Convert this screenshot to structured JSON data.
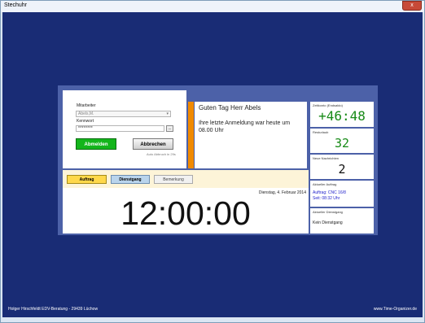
{
  "window": {
    "title": "Stechuhr",
    "close_glyph": "x"
  },
  "login": {
    "employee_label": "Mitarbeiter",
    "employee_value": "Abels,M.",
    "password_label": "Kennwort",
    "password_value": "********",
    "more_button": "...",
    "logout_button": "Abmelden",
    "cancel_button": "Abbrechen",
    "auto_cancel": "Auto Abbruch in 29s"
  },
  "greeting": {
    "headline": "Guten Tag Herr Abels",
    "message": "Ihre letzte Anmeldung war heute um 08.00 Uhr"
  },
  "tabs": [
    "Auftrag",
    "Dienstgang",
    "Bemerkung"
  ],
  "clock": {
    "date": "Dienstag, 4. Februar 2014",
    "time": "12:00:00"
  },
  "stats": {
    "zeitkonto": {
      "label": "Zeitkonto (Endsaldo)",
      "value": "+46:48"
    },
    "resturlaub": {
      "label": "Resturlaub",
      "value": "32"
    },
    "nachrichten": {
      "label": "Neue Nachrichten",
      "value": "2"
    },
    "auftrag": {
      "label": "Aktueller Auftrag",
      "line1": "Auftrag: CNC 16/8",
      "line2": "Seit: 08:32 Uhr"
    },
    "dienstgang": {
      "label": "Aktueller Dienstgang",
      "value": "Kein Dienstgang"
    }
  },
  "footer": {
    "left": "Holger Hirschfeldt EDV-Beratung - 29439 Lüchow",
    "right": "www.Time-Organizer.de"
  },
  "colors": {
    "background": "#192c75",
    "panel": "#4c61a8",
    "accent_green": "#13b51b",
    "orange": "#f08a00",
    "value_green": "#178a17",
    "link_blue": "#2222cc"
  }
}
